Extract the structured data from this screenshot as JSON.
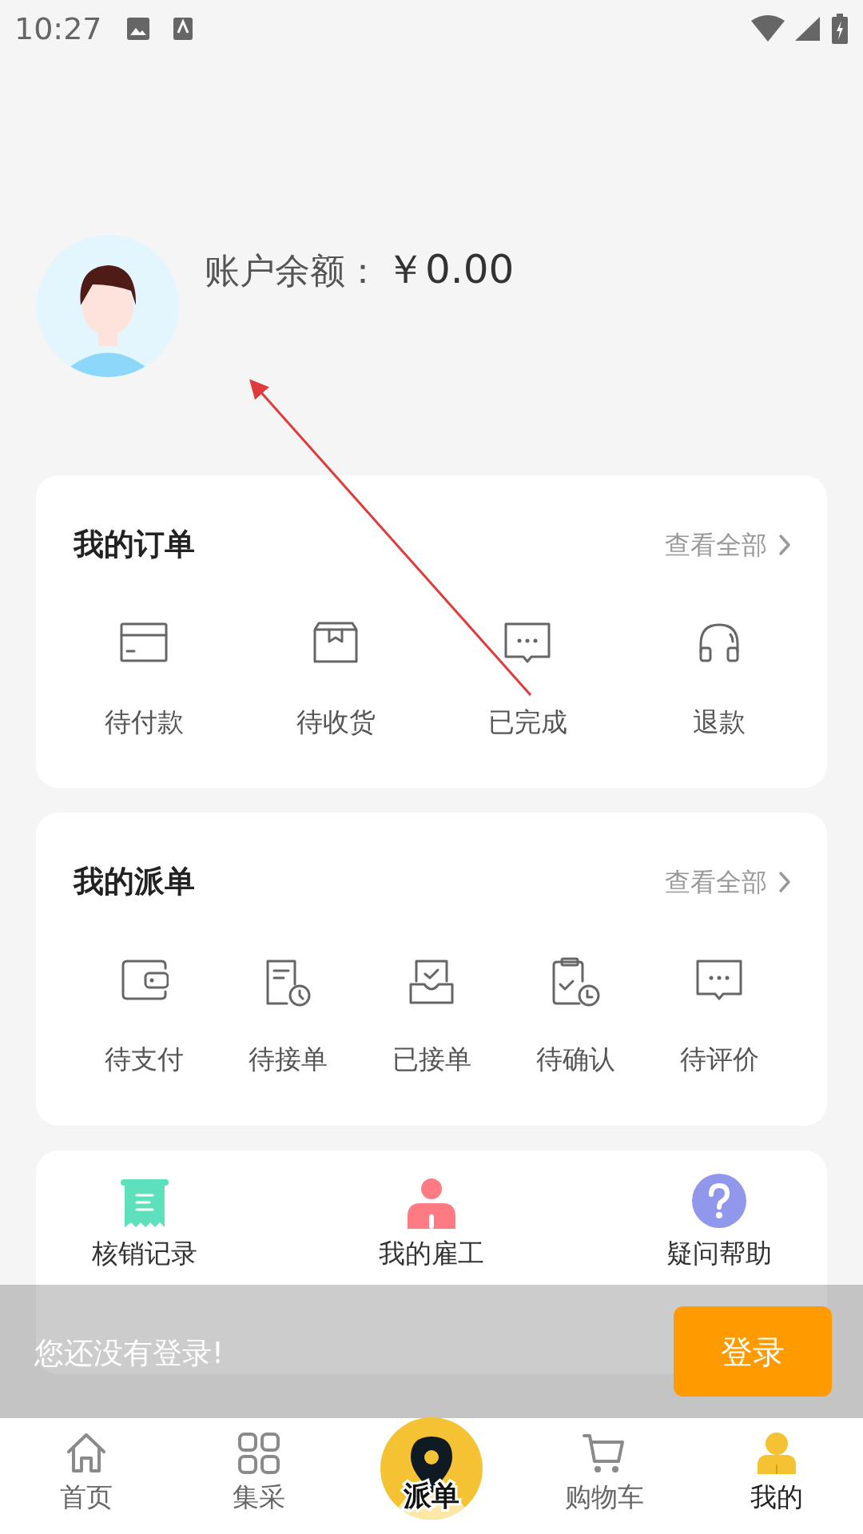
{
  "status_bar": {
    "time": "10:27"
  },
  "profile": {
    "balance_label": "账户余额：",
    "balance": "￥0.00"
  },
  "orders": {
    "title": "我的订单",
    "view_all": "查看全部",
    "items": [
      {
        "label": "待付款"
      },
      {
        "label": "待收货"
      },
      {
        "label": "已完成"
      },
      {
        "label": "退款"
      }
    ]
  },
  "dispatch": {
    "title": "我的派单",
    "view_all": "查看全部",
    "items": [
      {
        "label": "待支付"
      },
      {
        "label": "待接单"
      },
      {
        "label": "已接单"
      },
      {
        "label": "待确认"
      },
      {
        "label": "待评价"
      }
    ]
  },
  "tools": {
    "items": [
      {
        "label": "核销记录",
        "color": "#5ee0bd"
      },
      {
        "label": "我的雇工",
        "color": "#ff7b84"
      },
      {
        "label": "疑问帮助",
        "color": "#9198ec"
      }
    ]
  },
  "login_prompt": {
    "message": "您还没有登录!",
    "button": "登录"
  },
  "tab_bar": [
    {
      "label": "首页",
      "kind": "tab",
      "selected": false
    },
    {
      "label": "集采",
      "kind": "tab",
      "selected": false
    },
    {
      "label": "派单",
      "kind": "center",
      "selected": false
    },
    {
      "label": "购物车",
      "kind": "tab",
      "selected": false
    },
    {
      "label": "我的",
      "kind": "tab",
      "selected": true
    }
  ]
}
